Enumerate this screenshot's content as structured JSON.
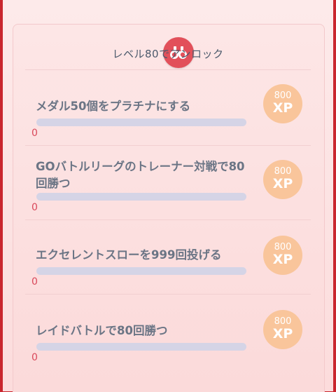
{
  "header": {
    "title": "レベル80でアンロック",
    "badge_icon": "binoculars-icon"
  },
  "tasks": [
    {
      "label": "メダル50個をプラチナにする",
      "progress_count": "0",
      "progress_fraction": 0,
      "reward_amount": "800",
      "reward_unit": "XP"
    },
    {
      "label": "GOバトルリーグのトレーナー対戦で80回勝つ",
      "progress_count": "0",
      "progress_fraction": 0,
      "reward_amount": "800",
      "reward_unit": "XP"
    },
    {
      "label": "エクセレントスローを999回投げる",
      "progress_count": "0",
      "progress_fraction": 0,
      "reward_amount": "800",
      "reward_unit": "XP"
    },
    {
      "label": "レイドバトルで80回勝つ",
      "progress_count": "0",
      "progress_fraction": 0,
      "reward_amount": "800",
      "reward_unit": "XP"
    }
  ],
  "colors": {
    "frame": "#c9262e",
    "badge": "#e2505a",
    "xp_bubble": "#f9c59b",
    "progress_track": "#d5d4e6",
    "count_text": "#d9485a"
  }
}
